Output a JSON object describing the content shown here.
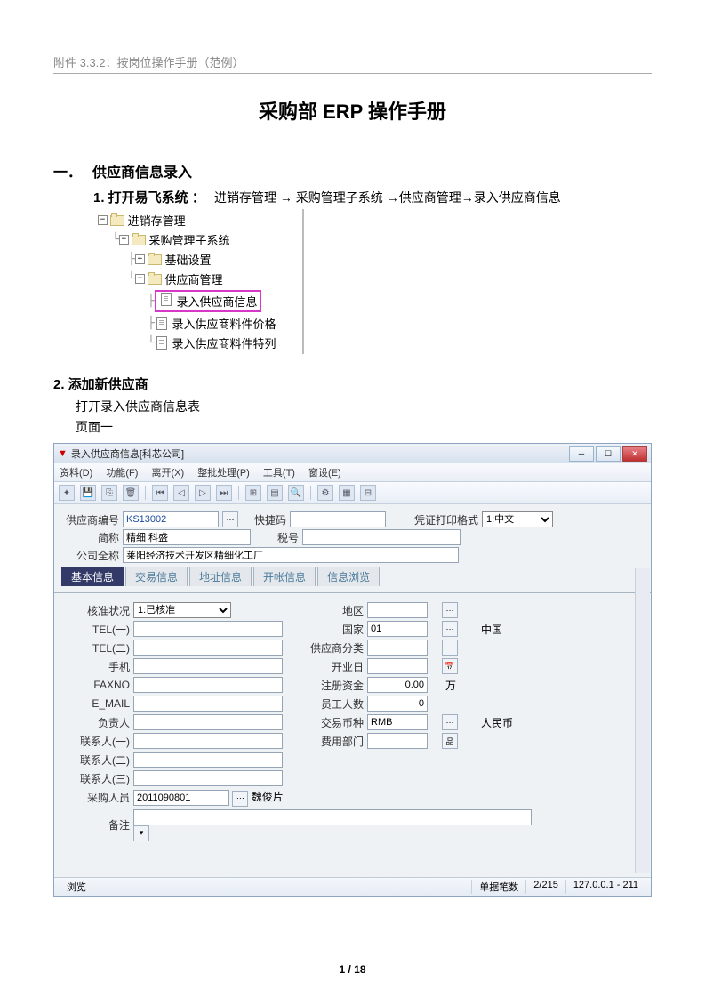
{
  "header": "附件 3.3.2：按岗位操作手册（范例）",
  "title": "采购部 ERP 操作手册",
  "section1": {
    "num": "一．",
    "heading": "供应商信息录入",
    "sub1": "1. 打开易飞系统 ：",
    "path": "进销存管理 → 采购管理子系统 →供应商管理→录入供应商信息"
  },
  "tree": {
    "n1": "进销存管理",
    "n2": "采购管理子系统",
    "n3": "基础设置",
    "n4": "供应商管理",
    "n5": "录入供应商信息",
    "n6": "录入供应商料件价格",
    "n7": "录入供应商料件特列"
  },
  "section2": {
    "heading": "2. 添加新供应商",
    "line1": "打开录入供应商信息表",
    "line2": "页面一"
  },
  "window": {
    "title": "录入供应商信息[科芯公司]"
  },
  "menu": {
    "m1": "资料(D)",
    "m2": "功能(F)",
    "m3": "离开(X)",
    "m4": "整批处理(P)",
    "m5": "工具(T)",
    "m6": "窗设(E)"
  },
  "form": {
    "supplier_no_lbl": "供应商编号",
    "supplier_no": "KS13002",
    "quick_lbl": "快捷码",
    "print_lbl": "凭证打印格式",
    "print_val": "1:中文",
    "short_lbl": "简称",
    "short_val": "精细 科盛",
    "tax_lbl": "税号",
    "full_lbl": "公司全称",
    "full_val": "莱阳经济技术开发区精细化工厂"
  },
  "tabs": {
    "t1": "基本信息",
    "t2": "交易信息",
    "t3": "地址信息",
    "t4": "开帐信息",
    "t5": "信息浏览"
  },
  "left": {
    "status_lbl": "核准状况",
    "status_val": "1:已核准",
    "tel1": "TEL(一)",
    "tel2": "TEL(二)",
    "mobile": "手机",
    "fax": "FAXNO",
    "email": "E_MAIL",
    "leader": "负责人",
    "c1": "联系人(一)",
    "c2": "联系人(二)",
    "c3": "联系人(三)",
    "buyer_lbl": "采购人员",
    "buyer_val": "2011090801",
    "buyer_name": "魏俊片",
    "remark": "备注"
  },
  "right": {
    "region": "地区",
    "country": "国家",
    "country_code": "01",
    "country_name": "中国",
    "cat": "供应商分类",
    "open": "开业日",
    "cap": "注册资金",
    "cap_val": "0.00",
    "cap_unit": "万",
    "emp": "员工人数",
    "emp_val": "0",
    "cur": "交易币种",
    "cur_code": "RMB",
    "cur_name": "人民币",
    "dept": "费用部门"
  },
  "status": {
    "mode": "浏览",
    "cnt_lbl": "单据笔数",
    "cnt": "2/215",
    "ip": "127.0.0.1 - 211"
  },
  "pagenum": "1 / 18"
}
